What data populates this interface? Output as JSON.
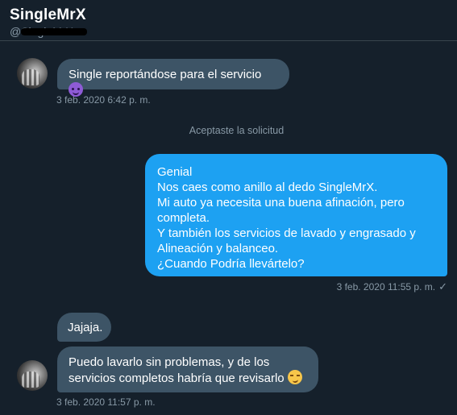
{
  "header": {
    "display_name": "SingleMrX",
    "handle_prefix": "@SingleMrX"
  },
  "messages": [
    {
      "id": "m1",
      "direction": "received",
      "text": "Single reportándose para el servicio",
      "emoji": "smiling-imp-emoji",
      "timestamp": "3 feb. 2020 6:42 p. m."
    },
    {
      "id": "sys1",
      "direction": "system",
      "text": "Aceptaste la solicitud"
    },
    {
      "id": "m2",
      "direction": "sent",
      "lines": [
        "Genial",
        "Nos caes como anillo al dedo SingleMrX.",
        "Mi auto ya necesita una buena afinación, pero",
        "completa.",
        "Y también los servicios de lavado y engrasado y",
        "Alineación y balanceo.",
        "¿Cuando Podría llevártelo?"
      ],
      "timestamp": "3 feb. 2020 11:55 p. m.",
      "status_icon": "check-icon"
    },
    {
      "id": "m3",
      "direction": "received",
      "text": "Jajaja."
    },
    {
      "id": "m4",
      "direction": "received",
      "lines": [
        "Puedo lavarlo sin problemas, y de los",
        "servicios completos habría que revisarlo"
      ],
      "emoji": "smirking-face-emoji",
      "timestamp": "3 feb. 2020 11:57 p. m."
    }
  ],
  "colors": {
    "background": "#15202b",
    "received_bubble": "#3d5466",
    "sent_bubble": "#1da1f2",
    "muted_text": "#8899a6",
    "divider": "#38444d"
  }
}
